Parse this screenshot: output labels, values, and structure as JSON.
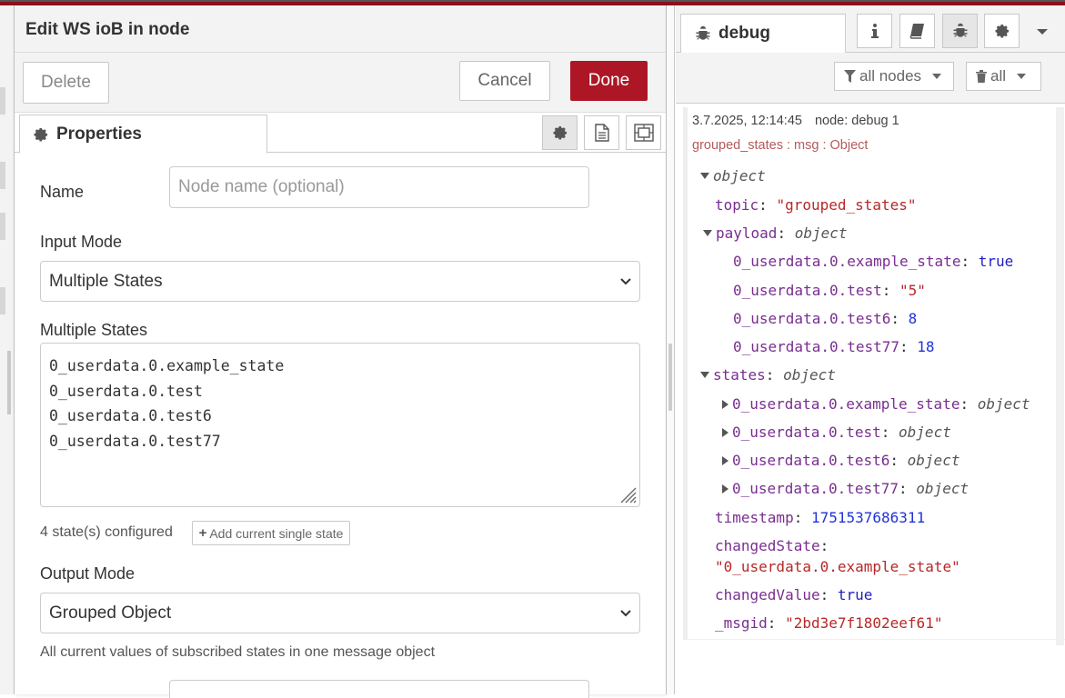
{
  "editor": {
    "title": "Edit WS ioB in node",
    "delete_label": "Delete",
    "cancel_label": "Cancel",
    "done_label": "Done",
    "tab_properties": "Properties",
    "tab_buttons": [
      "gear-icon",
      "description-icon",
      "appearance-icon"
    ],
    "form": {
      "name_label": "Name",
      "name_placeholder": "Node name (optional)",
      "input_mode_label": "Input Mode",
      "input_mode_value": "Multiple States",
      "multiple_states_label": "Multiple States",
      "states": [
        "0_userdata.0.example_state",
        "0_userdata.0.test",
        "0_userdata.0.test6",
        "0_userdata.0.test77"
      ],
      "states_count": "4 state(s) configured",
      "add_state_label": "Add current single state",
      "output_mode_label": "Output Mode",
      "output_mode_value": "Grouped Object",
      "output_hint": "All current values of subscribed states in one message object"
    }
  },
  "sidebar": {
    "tab_label": "debug",
    "tab_buttons": [
      "info-icon",
      "book-icon",
      "bug-icon",
      "gear-icon"
    ],
    "filter_nodes_label": "all nodes",
    "clear_label": "all",
    "message": {
      "timestamp": "3.7.2025, 12:14:45",
      "node": "node: debug 1",
      "name": "grouped_states : msg : Object",
      "root": "object",
      "topic_key": "topic",
      "topic_value": "\"grouped_states\"",
      "payload_key": "payload",
      "payload_type": "object",
      "payload": [
        {
          "key": "0_userdata.0.example_state",
          "value": "true",
          "kind": "b"
        },
        {
          "key": "0_userdata.0.test",
          "value": "\"5\"",
          "kind": "s"
        },
        {
          "key": "0_userdata.0.test6",
          "value": "8",
          "kind": "n"
        },
        {
          "key": "0_userdata.0.test77",
          "value": "18",
          "kind": "n"
        }
      ],
      "states_key": "states",
      "states_type": "object",
      "states": [
        {
          "key": "0_userdata.0.example_state",
          "value": "object"
        },
        {
          "key": "0_userdata.0.test",
          "value": "object"
        },
        {
          "key": "0_userdata.0.test6",
          "value": "object"
        },
        {
          "key": "0_userdata.0.test77",
          "value": "object"
        }
      ],
      "timestamp_key": "timestamp",
      "timestamp_value": "1751537686311",
      "changedState_key": "changedState",
      "changedState_value": "\"0_userdata.0.example_state\"",
      "changedValue_key": "changedValue",
      "changedValue_value": "true",
      "msgid_key": "_msgid",
      "msgid_value": "\"2bd3e7f1802eef61\""
    }
  },
  "colors": {
    "accent": "#ad1625",
    "top_bar": "#8c101c",
    "json_key": "#792e90",
    "json_string": "#b72828",
    "json_number": "#2033d6"
  }
}
